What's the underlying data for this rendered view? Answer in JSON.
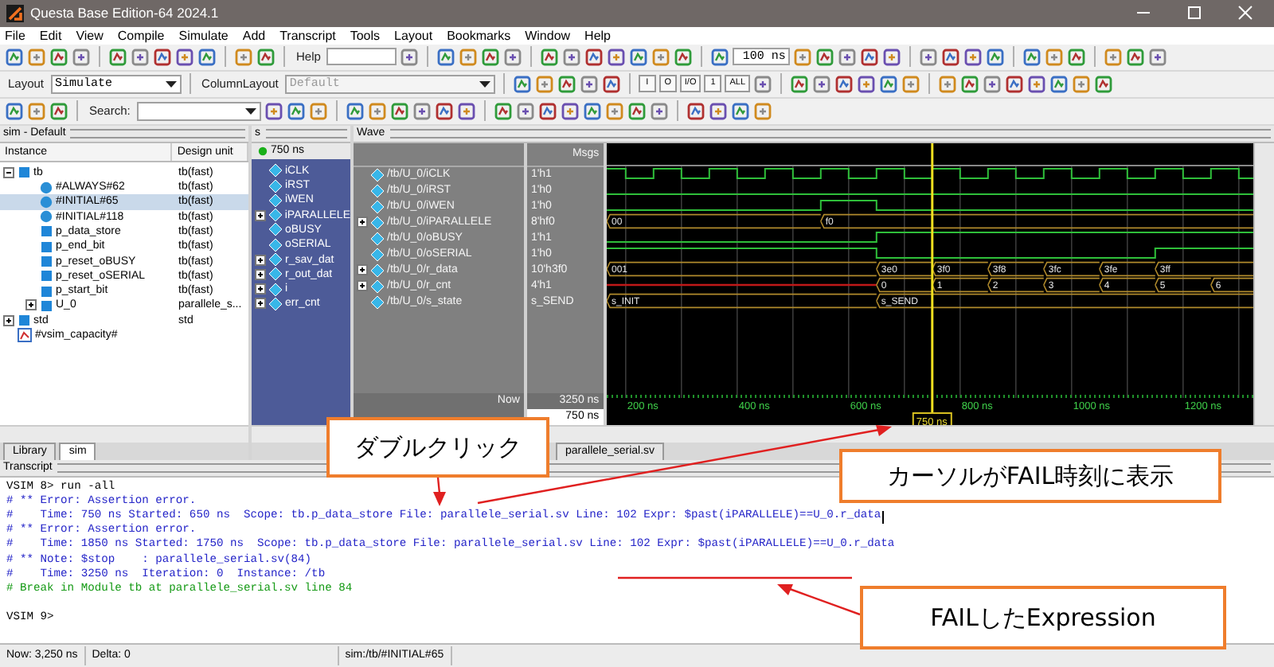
{
  "window": {
    "title": "Questa Base Edition-64 2024.1"
  },
  "menu": [
    "File",
    "Edit",
    "View",
    "Compile",
    "Simulate",
    "Add",
    "Transcript",
    "Tools",
    "Layout",
    "Bookmarks",
    "Window",
    "Help"
  ],
  "toolbar": {
    "help_label": "Help",
    "run_length": "100 ns",
    "layout_label": "Layout",
    "layout_value": "Simulate",
    "column_layout_label": "ColumnLayout",
    "column_layout_value": "Default",
    "column_layout_disabled": true,
    "search_label": "Search:",
    "wave_buttons": [
      "I",
      "O",
      "I/O",
      "1",
      "ALL"
    ]
  },
  "sim_panel": {
    "title": "sim - Default",
    "columns": [
      "Instance",
      "Design unit"
    ],
    "tree": [
      {
        "name": "tb",
        "unit": "tb(fast)",
        "kind": "module",
        "selected": false,
        "expanded": true,
        "children": [
          {
            "name": "#ALWAYS#62",
            "unit": "tb(fast)",
            "kind": "process",
            "selected": false
          },
          {
            "name": "#INITIAL#65",
            "unit": "tb(fast)",
            "kind": "process",
            "selected": true
          },
          {
            "name": "#INITIAL#118",
            "unit": "tb(fast)",
            "kind": "process",
            "selected": false
          },
          {
            "name": "p_data_store",
            "unit": "tb(fast)",
            "kind": "block",
            "selected": false
          },
          {
            "name": "p_end_bit",
            "unit": "tb(fast)",
            "kind": "block",
            "selected": false
          },
          {
            "name": "p_reset_oBUSY",
            "unit": "tb(fast)",
            "kind": "block",
            "selected": false
          },
          {
            "name": "p_reset_oSERIAL",
            "unit": "tb(fast)",
            "kind": "block",
            "selected": false
          },
          {
            "name": "p_start_bit",
            "unit": "tb(fast)",
            "kind": "block",
            "selected": false
          },
          {
            "name": "U_0",
            "unit": "parallele_s...",
            "kind": "module",
            "selected": false,
            "expanded": false
          }
        ]
      },
      {
        "name": "std",
        "unit": "std",
        "kind": "module",
        "selected": false,
        "expanded": false
      },
      {
        "name": "#vsim_capacity#",
        "kind": "capacity",
        "selected": false
      }
    ],
    "tabs": [
      {
        "label": "Library",
        "selected": false
      },
      {
        "label": "sim",
        "selected": true
      }
    ]
  },
  "objects_panel": {
    "title": "s",
    "time": "750 ns",
    "items": [
      {
        "name": "iCLK",
        "kind": "bit"
      },
      {
        "name": "iRST",
        "kind": "bit"
      },
      {
        "name": "iWEN",
        "kind": "bit"
      },
      {
        "name": "iPARALLELE",
        "kind": "bus"
      },
      {
        "name": "oBUSY",
        "kind": "bit"
      },
      {
        "name": "oSERIAL",
        "kind": "bit"
      },
      {
        "name": "r_sav_dat",
        "kind": "bus"
      },
      {
        "name": "r_out_dat",
        "kind": "bus"
      },
      {
        "name": "i",
        "kind": "bus"
      },
      {
        "name": "err_cnt",
        "kind": "bus"
      }
    ]
  },
  "wave": {
    "title": "Wave",
    "msgs_label": "Msgs",
    "now_label": "Now",
    "now_value": "3250 ns",
    "cursor_value": "750 ns",
    "cursor_label": "750 ns",
    "tab": "parallele_serial.sv",
    "ticks": [
      "200 ns",
      "400 ns",
      "600 ns",
      "800 ns",
      "1000 ns",
      "1200 ns"
    ],
    "signals": [
      {
        "path": "/tb/U_0/iCLK",
        "value": "1'h1",
        "kind": "bit"
      },
      {
        "path": "/tb/U_0/iRST",
        "value": "1'h0",
        "kind": "bit"
      },
      {
        "path": "/tb/U_0/iWEN",
        "value": "1'h0",
        "kind": "bit"
      },
      {
        "path": "/tb/U_0/iPARALLELE",
        "value": "8'hf0",
        "kind": "bus",
        "segments": [
          "00",
          "f0"
        ]
      },
      {
        "path": "/tb/U_0/oBUSY",
        "value": "1'h1",
        "kind": "bit"
      },
      {
        "path": "/tb/U_0/oSERIAL",
        "value": "1'h0",
        "kind": "bit"
      },
      {
        "path": "/tb/U_0/r_data",
        "value": "10'h3f0",
        "kind": "bus",
        "segments": [
          "001",
          "3e0",
          "3f0",
          "3f8",
          "3fc",
          "3fe",
          "3ff"
        ]
      },
      {
        "path": "/tb/U_0/r_cnt",
        "value": "4'h1",
        "kind": "bus",
        "segments": [
          "0",
          "1",
          "2",
          "3",
          "4",
          "5",
          "6"
        ]
      },
      {
        "path": "/tb/U_0/s_state",
        "value": "s_SEND",
        "kind": "state",
        "segments": [
          "s_INIT",
          "s_SEND"
        ]
      }
    ]
  },
  "transcript": {
    "title": "Transcript",
    "lines": [
      {
        "kind": "prompt",
        "text": "VSIM 8> run -all",
        "caret": false
      },
      {
        "kind": "message",
        "text": "# ** Error: Assertion error.",
        "caret": false
      },
      {
        "kind": "message",
        "text": "#    Time: 750 ns Started: 650 ns  Scope: tb.p_data_store File: parallele_serial.sv Line: 102 Expr: $past(iPARALLELE)==U_0.r_data",
        "caret": true
      },
      {
        "kind": "message",
        "text": "# ** Error: Assertion error.",
        "caret": false
      },
      {
        "kind": "message",
        "text": "#    Time: 1850 ns Started: 1750 ns  Scope: tb.p_data_store File: parallele_serial.sv Line: 102 Expr: $past(iPARALLELE)==U_0.r_data",
        "caret": false
      },
      {
        "kind": "message",
        "text": "# ** Note: $stop    : parallele_serial.sv(84)",
        "caret": false
      },
      {
        "kind": "message",
        "text": "#    Time: 3250 ns  Iteration: 0  Instance: /tb",
        "caret": false
      },
      {
        "kind": "break",
        "text": "# Break in Module tb at parallele_serial.sv line 84",
        "caret": false
      },
      {
        "kind": "input",
        "text": "VSIM 9>",
        "caret": false
      }
    ]
  },
  "status_bar": {
    "now": "Now: 3,250 ns",
    "delta": "Delta: 0",
    "context": "sim:/tb/#INITIAL#65"
  },
  "annotations": [
    {
      "text": "ダブルクリック"
    },
    {
      "text": "カーソルがFAIL時刻に表示"
    },
    {
      "text": "FAILしたExpression"
    }
  ]
}
